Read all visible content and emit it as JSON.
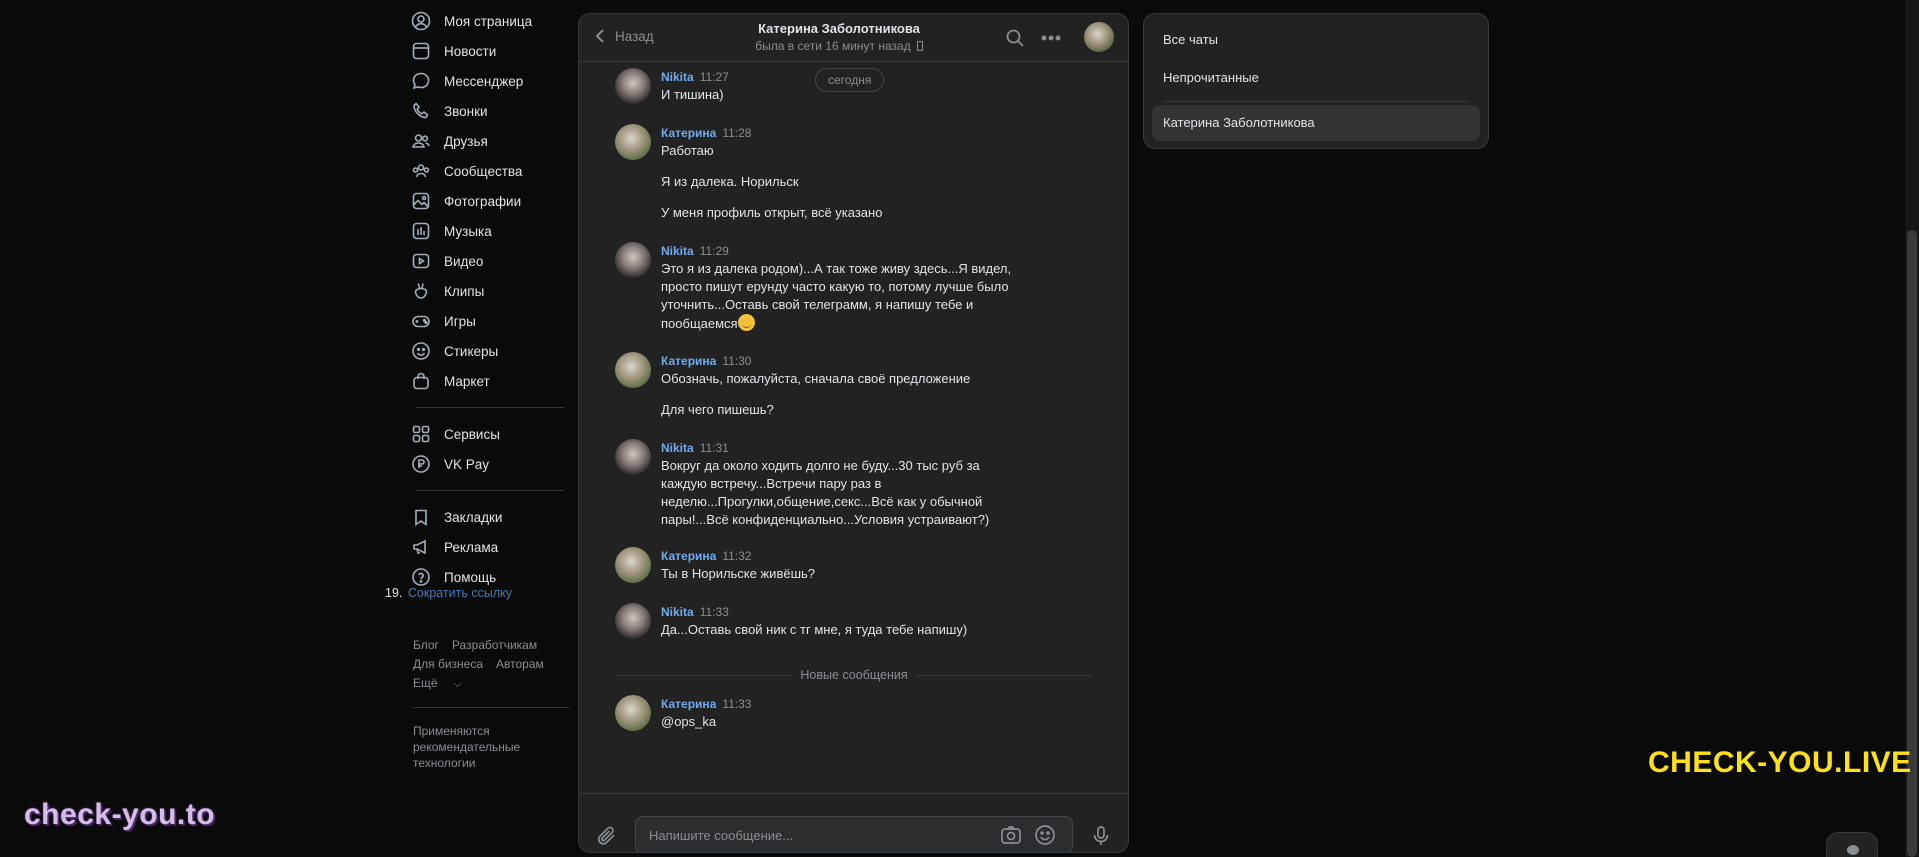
{
  "sidebar": {
    "items": [
      {
        "label": "Моя страница",
        "icon": "user-circle-icon"
      },
      {
        "label": "Новости",
        "icon": "newspaper-icon"
      },
      {
        "label": "Мессенджер",
        "icon": "message-bubble-icon"
      },
      {
        "label": "Звонки",
        "icon": "phone-icon"
      },
      {
        "label": "Друзья",
        "icon": "friends-icon"
      },
      {
        "label": "Сообщества",
        "icon": "communities-icon"
      },
      {
        "label": "Фотографии",
        "icon": "photo-icon"
      },
      {
        "label": "Музыка",
        "icon": "music-icon"
      },
      {
        "label": "Видео",
        "icon": "video-icon"
      },
      {
        "label": "Клипы",
        "icon": "clips-icon"
      },
      {
        "label": "Игры",
        "icon": "gamepad-icon"
      },
      {
        "label": "Стикеры",
        "icon": "sticker-icon"
      },
      {
        "label": "Маркет",
        "icon": "shopping-bag-icon"
      }
    ],
    "items2": [
      {
        "label": "Сервисы",
        "icon": "grid-icon"
      },
      {
        "label": "VK Pay",
        "icon": "ruble-icon"
      }
    ],
    "items3": [
      {
        "label": "Закладки",
        "icon": "bookmark-icon"
      },
      {
        "label": "Реклама",
        "icon": "megaphone-icon"
      },
      {
        "label": "Помощь",
        "icon": "question-icon"
      }
    ],
    "short_link_number": "19.",
    "short_link_label": "Сократить ссылку",
    "footer": {
      "blog": "Блог",
      "developers": "Разработчикам",
      "business": "Для бизнеса",
      "authors": "Авторам",
      "more": "Ещё",
      "note": "Применяются рекомендательные технологии"
    }
  },
  "chat": {
    "back_label": "Назад",
    "peer_name": "Катерина Заболотникова",
    "peer_status": "была в сети 16 минут назад",
    "date_pill": "сегодня",
    "new_messages_label": "Новые сообщения",
    "input_placeholder": "Напишите сообщение...",
    "messages": [
      {
        "author": "Nikita",
        "time": "11:27",
        "lines": [
          "И тишина)"
        ]
      },
      {
        "author": "Катерина",
        "time": "11:28",
        "lines": [
          "Работаю",
          "Я из далека. Норильск",
          "У меня профиль открыт, всё указано"
        ]
      },
      {
        "author": "Nikita",
        "time": "11:29",
        "lines": [
          "Это я из далека родом)...А так тоже живу здесь...Я видел, просто пишут ерунду часто какую то, потому лучше было уточнить...Оставь свой телеграмм, я напишу тебе и пообщаемся"
        ]
      },
      {
        "author": "Катерина",
        "time": "11:30",
        "lines": [
          "Обозначь, пожалуйста, сначала своё предложение",
          "Для чего пишешь?"
        ]
      },
      {
        "author": "Nikita",
        "time": "11:31",
        "lines": [
          "Вокруг да около ходить долго не буду...30 тыс руб за каждую встречу...Встречи пару раз в неделю...Прогулки,общение,секс...Всё как у обычной пары!...Всё конфиденциально...Условия устраивают?)"
        ]
      },
      {
        "author": "Катерина",
        "time": "11:32",
        "lines": [
          "Ты в Норильске живёшь?"
        ]
      },
      {
        "author": "Nikita",
        "time": "11:33",
        "lines": [
          "Да...Оставь свой ник с тг мне, я туда тебе напишу)"
        ]
      },
      {
        "author": "Катерина",
        "time": "11:33",
        "lines": [
          "@ops_ka"
        ]
      }
    ]
  },
  "folders": {
    "all": "Все чаты",
    "unread": "Непрочитанные",
    "custom": "Катерина Заболотникова"
  },
  "watermarks": {
    "left": "check-you.to",
    "right": "CHECK-YOU.LIVE"
  },
  "colors": {
    "background": "#0a0a0a",
    "panel": "#222222",
    "author_link": "#71aaeb",
    "watermark_right": "#ffe11a"
  }
}
